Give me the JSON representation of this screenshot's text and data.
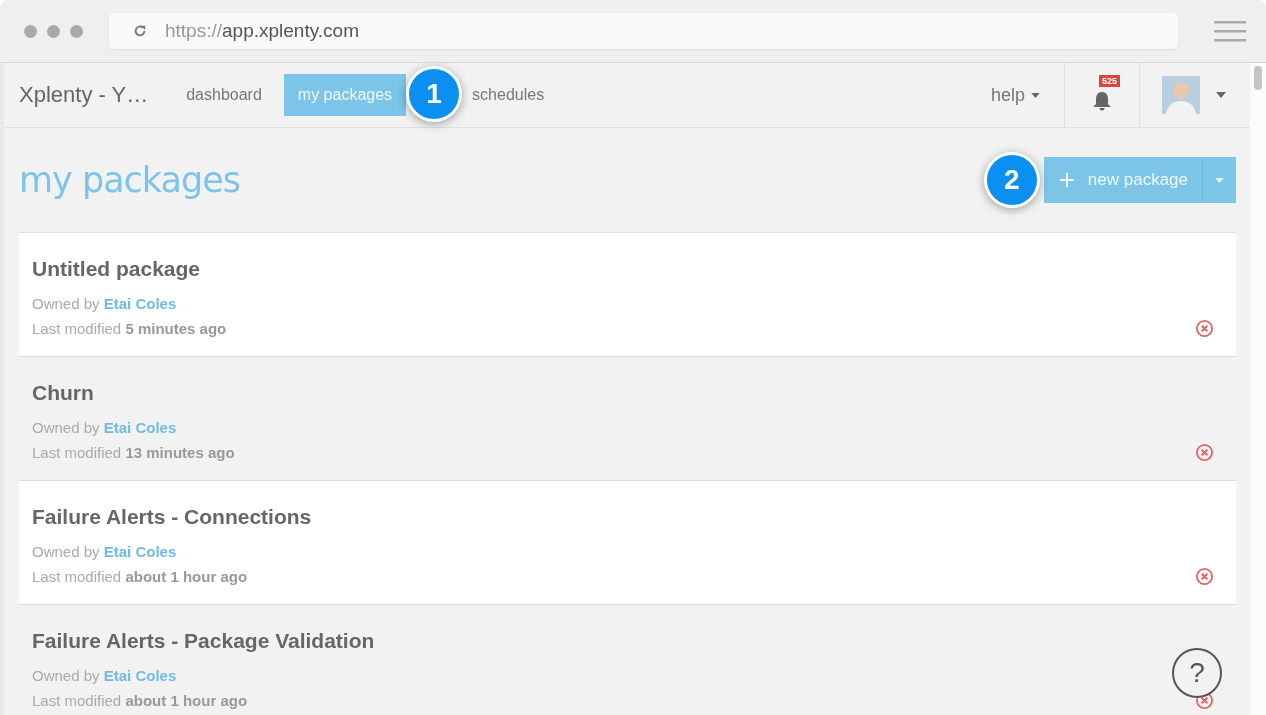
{
  "browser": {
    "url_scheme": "https://",
    "url_host": "app.xplenty.com"
  },
  "navbar": {
    "brand": "Xplenty - Y…",
    "tabs": [
      {
        "label": "dashboard",
        "selected": false
      },
      {
        "label": "my packages",
        "selected": true
      },
      {
        "label": "schedules",
        "selected": false
      }
    ],
    "help": "help",
    "notification_count": "525"
  },
  "page": {
    "title": "my packages",
    "new_button": "new package"
  },
  "packages": [
    {
      "name": "Untitled package",
      "owner_prefix": "Owned by",
      "owner": "Etai Coles",
      "modified": "Last modified **5 minutes ago**"
    },
    {
      "name": "Churn",
      "owner_prefix": "Owned by",
      "owner": "Etai Coles",
      "modified": "Last modified **13 minutes ago**"
    },
    {
      "name": "Failure Alerts - Connections",
      "owner_prefix": "Owned by",
      "owner": "Etai Coles",
      "modified": "Last modified **about 1 hour ago**"
    },
    {
      "name": "Failure Alerts - Package Validation",
      "owner_prefix": "Owned by",
      "owner": "Etai Coles",
      "modified": "Last modified **about 1 hour ago**"
    }
  ],
  "callouts": [
    "1",
    "2"
  ],
  "help_button": "?"
}
